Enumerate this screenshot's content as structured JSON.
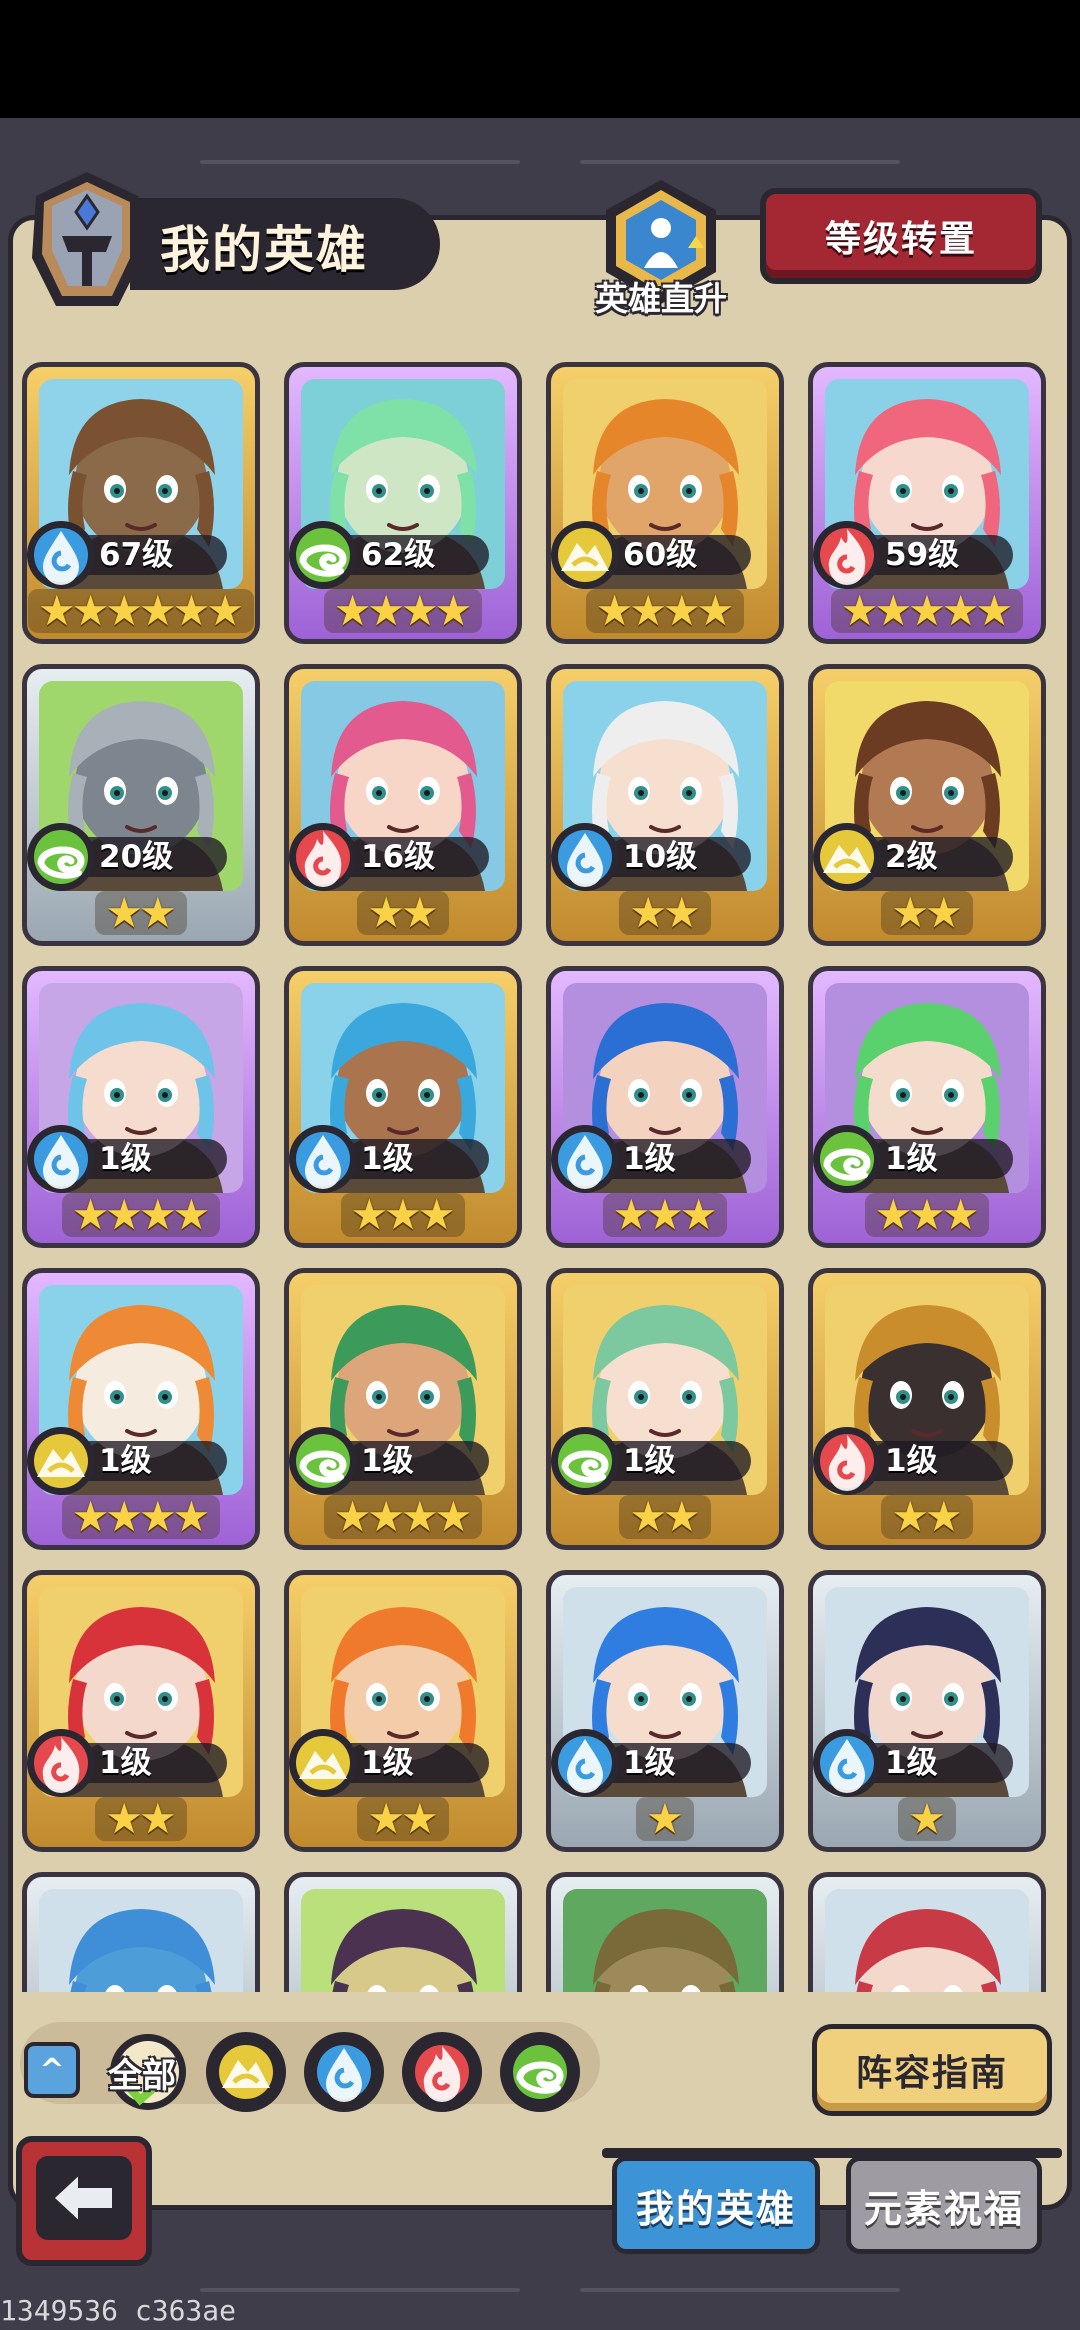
{
  "header": {
    "title": "我的英雄",
    "direct_up_label": "英雄直升",
    "level_transfer_label": "等级转置"
  },
  "colors": {
    "water": "#3b9be0",
    "wind": "#6bc23d",
    "earth": "#e5c93a",
    "fire": "#e5484d",
    "gold_frame": "#e8b64d",
    "purple_frame": "#c28ae8",
    "silver_frame": "#c9d2d8"
  },
  "heroes": [
    {
      "level": "67级",
      "element": "water",
      "stars": 6,
      "frame": "gold",
      "hair": "#7a5232",
      "skin": "#8b6a4a",
      "bg": "#8fd3ea"
    },
    {
      "level": "62级",
      "element": "wind",
      "stars": 4,
      "frame": "purple",
      "hair": "#7fe0a8",
      "skin": "#cfe6c5",
      "bg": "#7dd0d8"
    },
    {
      "level": "60级",
      "element": "earth",
      "stars": 4,
      "frame": "gold",
      "hair": "#e6862a",
      "skin": "#e1a56a",
      "bg": "#f0d06d"
    },
    {
      "level": "59级",
      "element": "fire",
      "stars": 5,
      "frame": "purple",
      "hair": "#f0667c",
      "skin": "#f7d8cf",
      "bg": "#8ad1e8"
    },
    {
      "level": "20级",
      "element": "wind",
      "stars": 2,
      "frame": "silver",
      "hair": "#a9b1b8",
      "skin": "#7d868e",
      "bg": "#9fd76d"
    },
    {
      "level": "16级",
      "element": "fire",
      "stars": 2,
      "frame": "gold",
      "hair": "#e25a8e",
      "skin": "#f7d6c8",
      "bg": "#86c9e5"
    },
    {
      "level": "10级",
      "element": "water",
      "stars": 2,
      "frame": "gold",
      "hair": "#eeeeee",
      "skin": "#f6dfcf",
      "bg": "#8ad2ea"
    },
    {
      "level": "2级",
      "element": "earth",
      "stars": 2,
      "frame": "gold",
      "hair": "#6b3b22",
      "skin": "#b27a52",
      "bg": "#f2da6a"
    },
    {
      "level": "1级",
      "element": "water",
      "stars": 4,
      "frame": "purple",
      "hair": "#6ec3e8",
      "skin": "#f5dccf",
      "bg": "#c7a6e8"
    },
    {
      "level": "1级",
      "element": "water",
      "stars": 3,
      "frame": "gold",
      "hair": "#3aa7dd",
      "skin": "#a9744e",
      "bg": "#8ad2ea"
    },
    {
      "level": "1级",
      "element": "water",
      "stars": 3,
      "frame": "purple",
      "hair": "#2c6fd4",
      "skin": "#f3d2c0",
      "bg": "#b48fe0"
    },
    {
      "level": "1级",
      "element": "wind",
      "stars": 3,
      "frame": "purple",
      "hair": "#5bd16e",
      "skin": "#f4dccd",
      "bg": "#b48fe0"
    },
    {
      "level": "1级",
      "element": "earth",
      "stars": 4,
      "frame": "purple",
      "hair": "#ee8a35",
      "skin": "#f5ecdf",
      "bg": "#8ad2ea"
    },
    {
      "level": "1级",
      "element": "wind",
      "stars": 4,
      "frame": "gold",
      "hair": "#3c9a5a",
      "skin": "#dca57a",
      "bg": "#f0d06d"
    },
    {
      "level": "1级",
      "element": "wind",
      "stars": 2,
      "frame": "gold",
      "hair": "#7cc9a0",
      "skin": "#f6dfcf",
      "bg": "#f0d06d"
    },
    {
      "level": "1级",
      "element": "fire",
      "stars": 2,
      "frame": "gold",
      "hair": "#c98d2c",
      "skin": "#3a3030",
      "bg": "#f0d06d"
    },
    {
      "level": "1级",
      "element": "fire",
      "stars": 2,
      "frame": "gold",
      "hair": "#d8333a",
      "skin": "#f5d8cc",
      "bg": "#f0d06d"
    },
    {
      "level": "1级",
      "element": "earth",
      "stars": 2,
      "frame": "gold",
      "hair": "#f07a2c",
      "skin": "#f3ccaa",
      "bg": "#f0d06d"
    },
    {
      "level": "1级",
      "element": "water",
      "stars": 1,
      "frame": "silver",
      "hair": "#2f7de0",
      "skin": "#f6dccd",
      "bg": "#cfe0ea"
    },
    {
      "level": "1级",
      "element": "water",
      "stars": 1,
      "frame": "silver",
      "hair": "#2c2f58",
      "skin": "#f2d8cc",
      "bg": "#cfe0ea"
    },
    {
      "level": "",
      "element": "",
      "stars": 0,
      "frame": "silver",
      "hair": "#3f8fd8",
      "skin": "#4d9ed8",
      "bg": "#cfe0ea"
    },
    {
      "level": "",
      "element": "",
      "stars": 0,
      "frame": "silver",
      "hair": "#4a3250",
      "skin": "#d7c98a",
      "bg": "#b9e07a"
    },
    {
      "level": "",
      "element": "",
      "stars": 0,
      "frame": "silver",
      "hair": "#7a6a3a",
      "skin": "#9c8a5a",
      "bg": "#5ea860"
    },
    {
      "level": "",
      "element": "",
      "stars": 0,
      "frame": "silver",
      "hair": "#c83a46",
      "skin": "#f4d8cc",
      "bg": "#cfe0ea"
    }
  ],
  "filters": {
    "collapse_icon": "^",
    "all_label": "全部",
    "elements": [
      "earth",
      "water",
      "fire",
      "wind"
    ]
  },
  "guide_label": "阵容指南",
  "tabs": {
    "my_heroes": "我的英雄",
    "element_blessing": "元素祝福"
  },
  "footer_id": "1349536 c363ae"
}
